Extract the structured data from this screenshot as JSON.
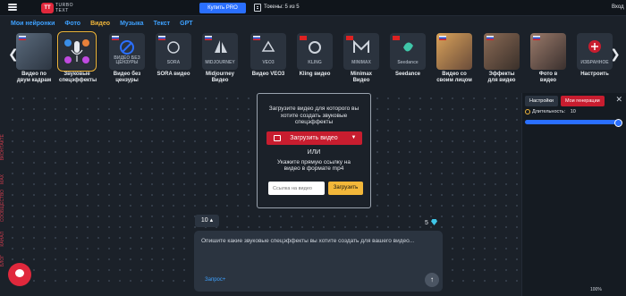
{
  "header": {
    "logo_mark": "TT",
    "logo_text_1": "TURBO",
    "logo_text_2": "TEXT",
    "pro_button": "Купить PRO",
    "tokens_label": "Токены: 5 из 5",
    "login": "Вход"
  },
  "nav": [
    "Мои нейронки",
    "Фото",
    "Видео",
    "Музыка",
    "Текст",
    "GPT"
  ],
  "cards": [
    {
      "label": "Видео по двум кадрам",
      "bg": "#3a4656"
    },
    {
      "label": "Звуковые спецэффекты",
      "bg": "#2a2f38"
    },
    {
      "label": "Видео без цензуры",
      "thumb": "ВИДЕО БЕЗ ЦЕНЗУРЫ",
      "bg": "#2b333e"
    },
    {
      "label": "SORA видео",
      "thumb": "SORA",
      "bg": "#2b333e"
    },
    {
      "label": "Midjourney Видео",
      "thumb": "MIDJOURNEY",
      "bg": "#2b333e"
    },
    {
      "label": "Видео VEO3",
      "thumb": "VEO3",
      "bg": "#2b333e"
    },
    {
      "label": "Kling видео",
      "thumb": "KLING",
      "bg": "#2b333e"
    },
    {
      "label": "Minimax Видео",
      "thumb": "MINIMAX",
      "bg": "#2b333e"
    },
    {
      "label": "Seedance",
      "thumb": "Seedance",
      "bg": "#2b333e"
    },
    {
      "label": "Видео со своим лицом",
      "bg": "#5a4a3a"
    },
    {
      "label": "Эффекты для видео",
      "bg": "#4a4038"
    },
    {
      "label": "Фото в видео",
      "bg": "#554a45"
    },
    {
      "label": "Настроить",
      "thumb": "ИЗБРАННОЕ",
      "bg": "#2b333e"
    }
  ],
  "upload": {
    "text": "Загрузите видео для которого вы хотите создать звуковые спецэффекты",
    "button": "Загрузить видео",
    "or": "ИЛИ",
    "url_text": "Укажите прямую ссылку на видео в формате mp4",
    "url_placeholder": "Ссылка на видео",
    "url_button": "Загрузить"
  },
  "side_links": [
    "БЛОГ",
    "КАНАЛ",
    "СООБЩЕСТВО",
    "MAX",
    "ВКОНТАКТЕ"
  ],
  "count": "10",
  "tokens_cost": "5",
  "prompt": {
    "text": "Опишите какие звуковые спецэффекты вы хотите создать для вашего видео...",
    "link": "Запрос+"
  },
  "panel": {
    "tab_settings": "Настройки",
    "tab_gen": "Мои генерации",
    "duration_label": "Длительность:",
    "duration_value": "10",
    "duration_fraction": 1.0
  },
  "zoom": "100%",
  "colors": {
    "accent_red": "#c81d2f",
    "accent_blue": "#2a6fff",
    "accent_yellow": "#f2b73a",
    "nav_link": "#3ea1ff"
  }
}
